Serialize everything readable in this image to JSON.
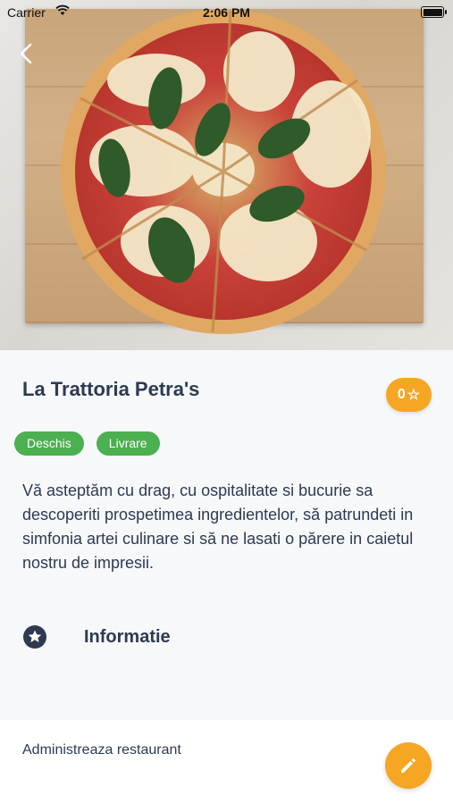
{
  "status_bar": {
    "carrier": "Carrier",
    "time": "2:06 PM"
  },
  "hero": {
    "image": "pizza-margherita-photo",
    "back_icon": "chevron-left-icon"
  },
  "restaurant": {
    "name": "La Trattoria Petra's",
    "rating_value": "0",
    "rating_star": "☆",
    "tags": [
      "Deschis",
      "Livrare"
    ],
    "description": "Vă asteptăm cu drag, cu ospitalitate si bucurie sa descoperiti prospetimea ingredientelor, să patrundeti in simfonia artei culinare si să ne lasati o părere in caietul nostru de impresii."
  },
  "info_section": {
    "icon": "star-circle-icon",
    "label": "Informatie"
  },
  "admin": {
    "label": "Administreaza restaurant",
    "edit_icon": "pencil-icon"
  },
  "colors": {
    "accent": "#f5a623",
    "tag_green": "#4caf50",
    "text_dark": "#2d3a52",
    "background": "#f7f8fa"
  }
}
